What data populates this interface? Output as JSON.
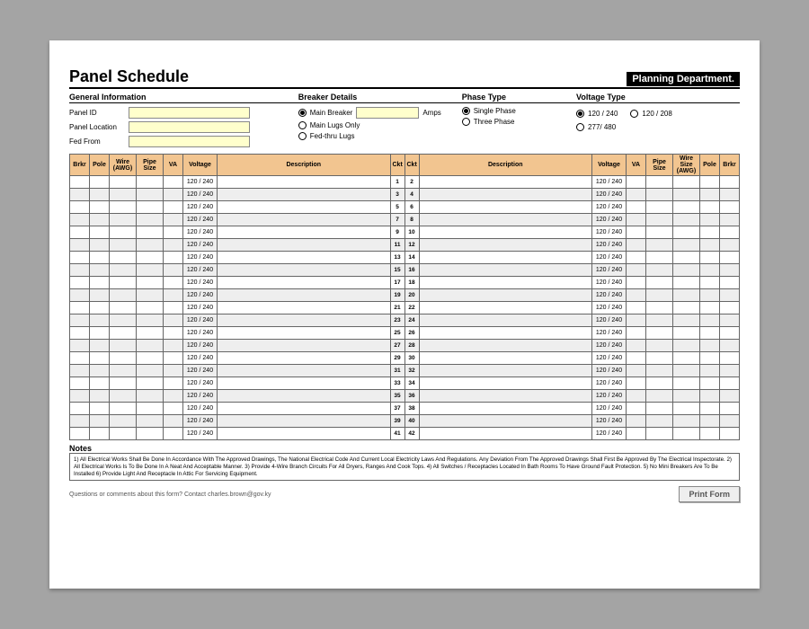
{
  "header": {
    "title": "Panel Schedule",
    "badge": "Planning Department."
  },
  "sections": {
    "general": {
      "heading": "General Information",
      "fields": {
        "panel_id_label": "Panel ID",
        "panel_location_label": "Panel Location",
        "fed_from_label": "Fed From"
      }
    },
    "breaker": {
      "heading": "Breaker Details",
      "options": {
        "main_breaker": "Main Breaker",
        "main_lugs": "Main Lugs Only",
        "fed_thru": "Fed-thru Lugs"
      },
      "amps_label": "Amps",
      "selected": "main_breaker"
    },
    "phase": {
      "heading": "Phase Type",
      "options": {
        "single": "Single Phase",
        "three": "Three Phase"
      },
      "selected": "single"
    },
    "voltage": {
      "heading": "Voltage Type",
      "options": {
        "v120_240": "120 / 240",
        "v120_208": "120 / 208",
        "v277_480": "277/ 480"
      },
      "selected": "v120_240"
    }
  },
  "columns": {
    "left": [
      "Brkr",
      "Pole",
      "Wire (AWG)",
      "Pipe Size",
      "VA",
      "Voltage",
      "Description",
      "Ckt"
    ],
    "right": [
      "Ckt",
      "Description",
      "Voltage",
      "VA",
      "Pipe Size",
      "Wire Size (AWG)",
      "Pole",
      "Brkr"
    ]
  },
  "rows": [
    {
      "ckt_l": 1,
      "ckt_r": 2,
      "volt_l": "120 / 240",
      "volt_r": "120 / 240"
    },
    {
      "ckt_l": 3,
      "ckt_r": 4,
      "volt_l": "120 / 240",
      "volt_r": "120 / 240"
    },
    {
      "ckt_l": 5,
      "ckt_r": 6,
      "volt_l": "120 / 240",
      "volt_r": "120 / 240"
    },
    {
      "ckt_l": 7,
      "ckt_r": 8,
      "volt_l": "120 / 240",
      "volt_r": "120 / 240"
    },
    {
      "ckt_l": 9,
      "ckt_r": 10,
      "volt_l": "120 / 240",
      "volt_r": "120 / 240"
    },
    {
      "ckt_l": 11,
      "ckt_r": 12,
      "volt_l": "120 / 240",
      "volt_r": "120 / 240"
    },
    {
      "ckt_l": 13,
      "ckt_r": 14,
      "volt_l": "120 / 240",
      "volt_r": "120 / 240"
    },
    {
      "ckt_l": 15,
      "ckt_r": 16,
      "volt_l": "120 / 240",
      "volt_r": "120 / 240"
    },
    {
      "ckt_l": 17,
      "ckt_r": 18,
      "volt_l": "120 / 240",
      "volt_r": "120 / 240"
    },
    {
      "ckt_l": 19,
      "ckt_r": 20,
      "volt_l": "120 / 240",
      "volt_r": "120 / 240"
    },
    {
      "ckt_l": 21,
      "ckt_r": 22,
      "volt_l": "120 / 240",
      "volt_r": "120 / 240"
    },
    {
      "ckt_l": 23,
      "ckt_r": 24,
      "volt_l": "120 / 240",
      "volt_r": "120 / 240"
    },
    {
      "ckt_l": 25,
      "ckt_r": 26,
      "volt_l": "120 / 240",
      "volt_r": "120 / 240"
    },
    {
      "ckt_l": 27,
      "ckt_r": 28,
      "volt_l": "120 / 240",
      "volt_r": "120 / 240"
    },
    {
      "ckt_l": 29,
      "ckt_r": 30,
      "volt_l": "120 / 240",
      "volt_r": "120 / 240"
    },
    {
      "ckt_l": 31,
      "ckt_r": 32,
      "volt_l": "120 / 240",
      "volt_r": "120 / 240"
    },
    {
      "ckt_l": 33,
      "ckt_r": 34,
      "volt_l": "120 / 240",
      "volt_r": "120 / 240"
    },
    {
      "ckt_l": 35,
      "ckt_r": 36,
      "volt_l": "120 / 240",
      "volt_r": "120 / 240"
    },
    {
      "ckt_l": 37,
      "ckt_r": 38,
      "volt_l": "120 / 240",
      "volt_r": "120 / 240"
    },
    {
      "ckt_l": 39,
      "ckt_r": 40,
      "volt_l": "120 / 240",
      "volt_r": "120 / 240"
    },
    {
      "ckt_l": 41,
      "ckt_r": 42,
      "volt_l": "120 / 240",
      "volt_r": "120 / 240"
    }
  ],
  "notes": {
    "heading": "Notes",
    "text": "1) All Electrical Works Shall Be Done In Accordance With The Approved Drawings, The National Electrical Code And Current Local Electricity Laws And Regulations. Any Deviation From The Approved Drawings Shall First Be Approved By The Electrical Inspectorate.  2) All Electrical Works Is To Be Done In A Neat And Acceptable Manner.  3) Provide 4-Wire Branch Circuits For All Dryers, Ranges And Cook Tops.  4) All Switches / Receptacles Located In Bath Rooms To Have Ground Fault Protection.  5) No Mini Breakers Are To Be Installed  6) Provide Light And Receptacle In Attic For Servicing Equipment."
  },
  "footer": {
    "contact": "Questions or comments about this form? Contact charles.brown@gov.ky",
    "print": "Print Form"
  }
}
